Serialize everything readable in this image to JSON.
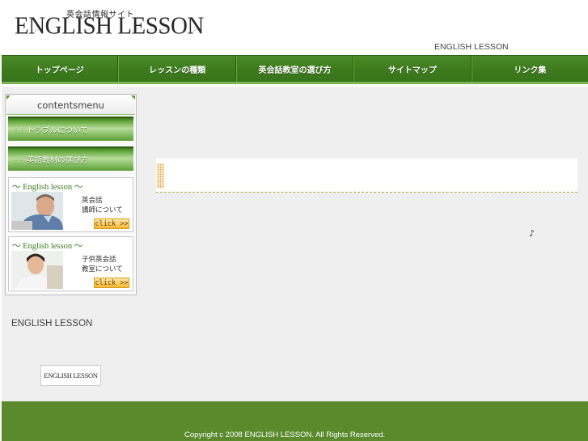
{
  "header": {
    "subtitle": "英会話情報サイト",
    "logo": "ENGLISH LESSON",
    "right_text": "ENGLISH LESSON"
  },
  "nav": {
    "items": [
      {
        "label": "トップページ"
      },
      {
        "label": "レッスンの種類"
      },
      {
        "label": "英会話教室の選び方"
      },
      {
        "label": "サイトマップ"
      },
      {
        "label": "リンク集"
      }
    ]
  },
  "sidebar": {
    "menu_title": "contentsmenu",
    "items": [
      {
        "label": "トラブルについて"
      },
      {
        "label": "英語教材の選び方"
      }
    ],
    "banners": [
      {
        "title": "〜 English lesson 〜",
        "line1": "英会話",
        "line2": "講師について",
        "click": "click >>"
      },
      {
        "title": "〜 English lesson 〜",
        "line1": "子供英会話",
        "line2": "教室について",
        "click": "click >>"
      }
    ],
    "footer_text": "ENGLISH LESSON",
    "mini_logo": "ENGLISH LESSON"
  },
  "main": {
    "note": "♪"
  },
  "footer": {
    "copyright": "Copyright c 2008 ENGLISH LESSON. All Rights Reserved."
  },
  "colors": {
    "nav_green": "#3f7d1f",
    "footer_green": "#5a8a2c",
    "accent_orange": "#e8a335"
  }
}
